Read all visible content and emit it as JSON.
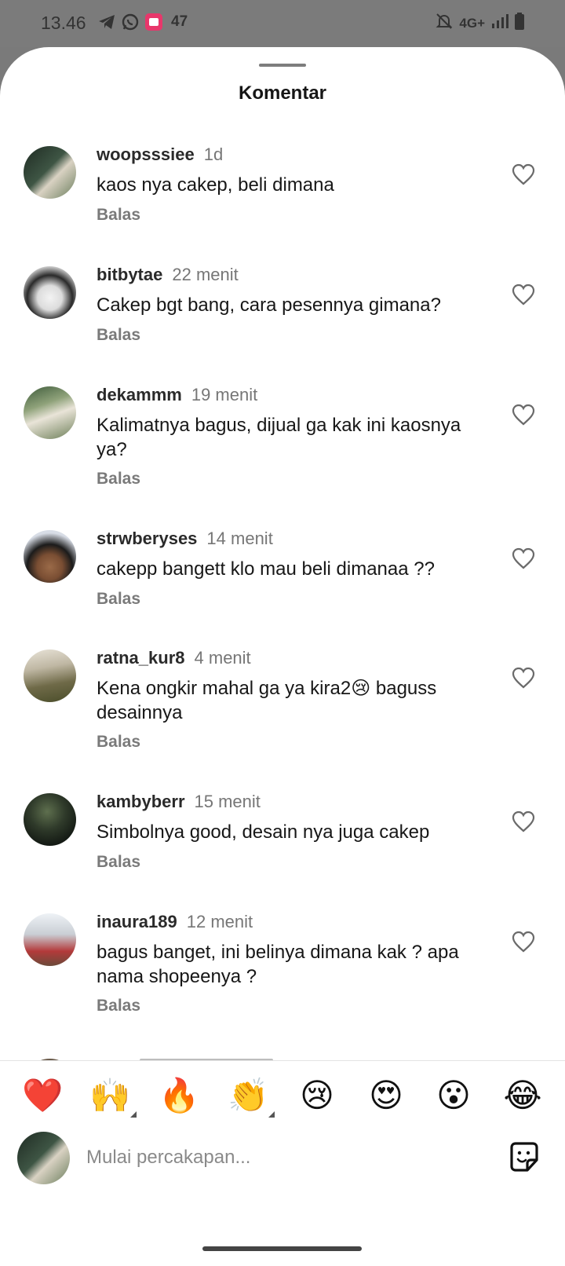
{
  "status_bar": {
    "time": "13.46",
    "notif_count": "47",
    "network": "4G+"
  },
  "sheet": {
    "title": "Komentar"
  },
  "comments": [
    {
      "user": "woopsssiee",
      "time": "1d",
      "text": "kaos nya cakep, beli dimana",
      "reply": "Balas"
    },
    {
      "user": "bitbytae",
      "time": "22 menit",
      "text": "Cakep bgt bang, cara pesennya gimana?",
      "reply": "Balas"
    },
    {
      "user": "dekammm",
      "time": "19 menit",
      "text": "Kalimatnya bagus, dijual ga kak ini kaosnya ya?",
      "reply": "Balas"
    },
    {
      "user": "strwberyses",
      "time": "14 menit",
      "text": "cakepp bangett klo mau beli dimanaa ??",
      "reply": "Balas"
    },
    {
      "user": "ratna_kur8",
      "time": "4 menit",
      "text": "Kena ongkir mahal ga ya kira2😢 baguss desainnya",
      "reply": "Balas"
    },
    {
      "user": "kambyberr",
      "time": "15 menit",
      "text": "Simbolnya good, desain nya juga cakep",
      "reply": "Balas"
    },
    {
      "user": "inaura189",
      "time": "12 menit",
      "text": "bagus banget, ini belinya dimana kak ? apa nama shopeenya ?",
      "reply": "Balas"
    }
  ],
  "emoji_bar": [
    "❤️",
    "🙌",
    "🔥",
    "👏",
    "😢",
    "😍",
    "😮",
    "😂"
  ],
  "composer": {
    "placeholder": "Mulai percakapan..."
  }
}
